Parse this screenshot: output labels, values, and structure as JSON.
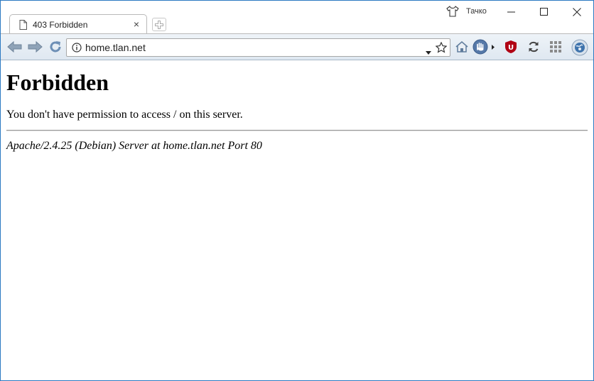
{
  "tab": {
    "title": "403 Forbidden",
    "close": "×"
  },
  "profile": {
    "name": "Тачко"
  },
  "omnibox": {
    "url": "home.tlan.net"
  },
  "page": {
    "heading": "Forbidden",
    "message": "You don't have permission to access / on this server.",
    "footer": "Apache/2.4.25 (Debian) Server at home.tlan.net Port 80"
  },
  "icons": [
    "page-favicon-icon",
    "new-tab-icon",
    "profile-icon",
    "minimize-icon",
    "maximize-icon",
    "window-close-icon",
    "back-arrow-icon",
    "forward-arrow-icon",
    "reload-icon",
    "info-icon",
    "dropdown-icon",
    "star-icon",
    "home-icon",
    "stop-hand-icon",
    "ublock-icon",
    "sync-icon",
    "apps-grid-icon",
    "extension-globe-icon"
  ],
  "colors": {
    "window_border": "#2b79c2",
    "toolbar_top": "#eef3f8",
    "toolbar_bottom": "#dfe8f1",
    "ublock_red": "#b00014"
  }
}
